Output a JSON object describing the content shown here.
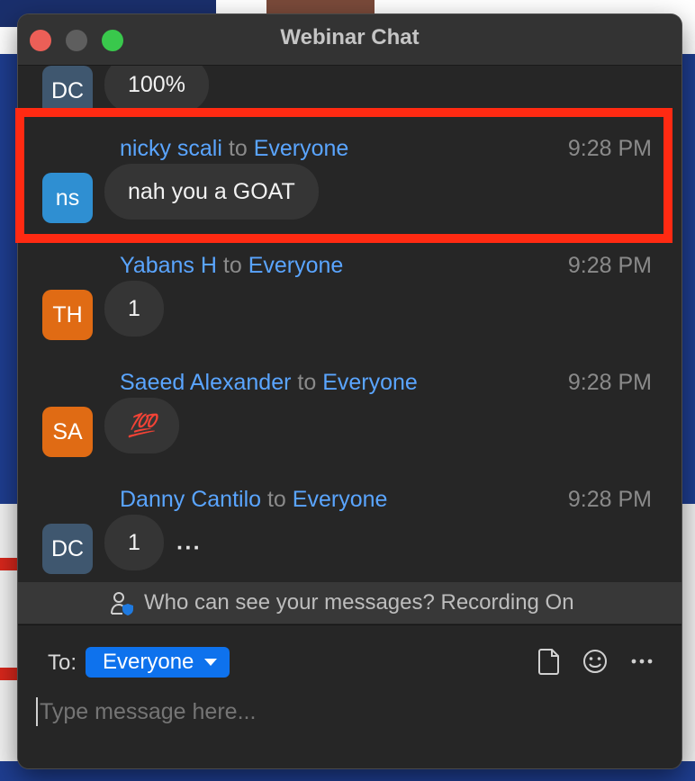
{
  "window": {
    "title": "Webinar Chat"
  },
  "messages": [
    {
      "avatar": "DC",
      "avatar_color": "#3f576f",
      "sender": "",
      "recipient": "",
      "time": "",
      "text": "100%"
    },
    {
      "avatar": "ns",
      "avatar_color": "#2f8fd2",
      "sender": "nicky scali",
      "to_word": "to",
      "recipient": "Everyone",
      "time": "9:28 PM",
      "text": "nah you a GOAT"
    },
    {
      "avatar": "TH",
      "avatar_color": "#e06b14",
      "sender": "Yabans H",
      "to_word": "to",
      "recipient": "Everyone",
      "time": "9:28 PM",
      "text": "1"
    },
    {
      "avatar": "SA",
      "avatar_color": "#e06b14",
      "sender": "Saeed Alexander",
      "to_word": "to",
      "recipient": "Everyone",
      "time": "9:28 PM",
      "text": "💯"
    },
    {
      "avatar": "DC",
      "avatar_color": "#3f576f",
      "sender": "Danny Cantilo",
      "to_word": "to",
      "recipient": "Everyone",
      "time": "9:28 PM",
      "text": "1",
      "more": "···"
    }
  ],
  "privacy_notice": "Who can see your messages? Recording On",
  "composer": {
    "to_label": "To:",
    "recipient": "Everyone",
    "placeholder": "Type message here...",
    "icons": [
      "file-icon",
      "emoji-icon",
      "more-icon"
    ]
  },
  "colors": {
    "accent": "#0e72ed",
    "highlight": "#ff2a12",
    "sender": "#5aa5ff"
  }
}
